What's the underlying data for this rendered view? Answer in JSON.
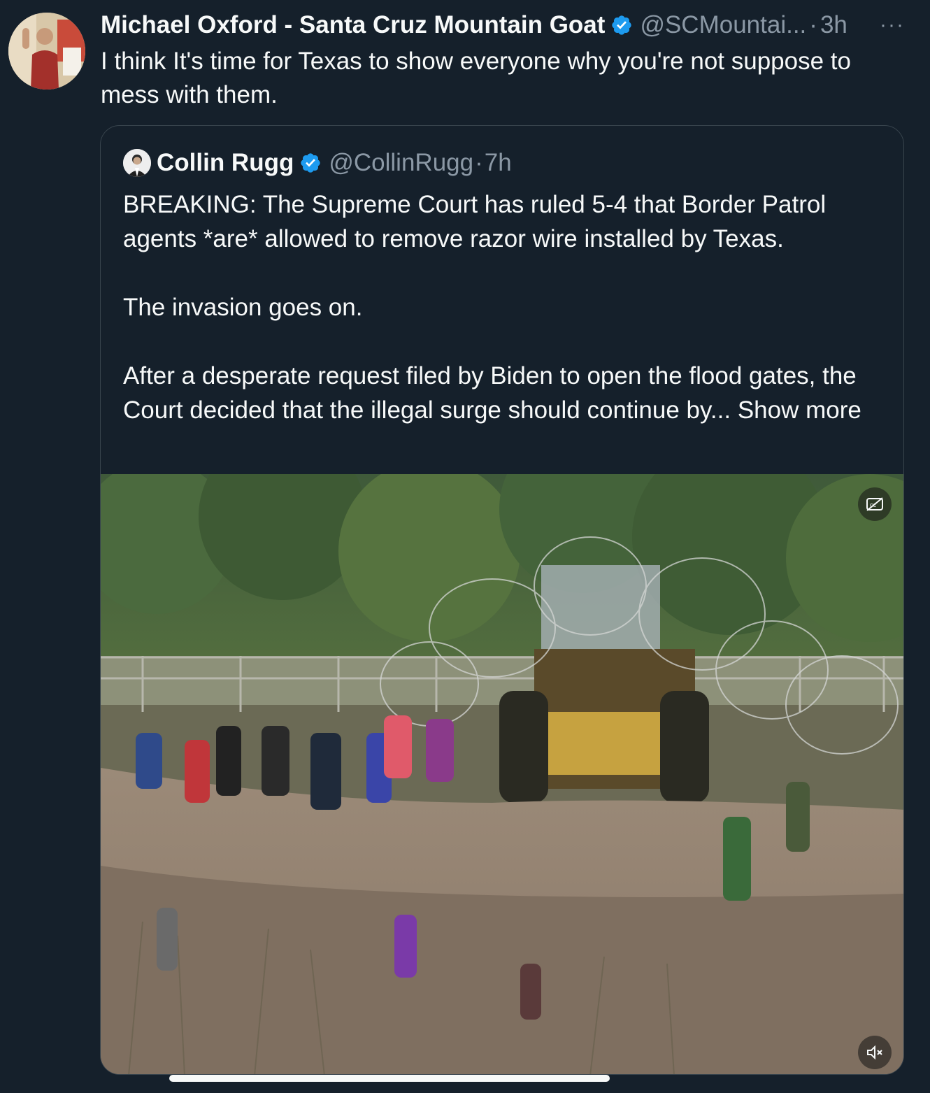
{
  "tweet": {
    "author_name": "Michael Oxford - Santa Cruz Mountain Goat",
    "handle": "@SCMountai...",
    "separator": "·",
    "time": "3h",
    "more_label": "···",
    "text": "I think It's time for Texas to show everyone why you're not suppose to mess with them.",
    "verified": true
  },
  "quote": {
    "author_name": "Collin Rugg",
    "handle": "@CollinRugg",
    "separator": "·",
    "time": "7h",
    "verified": true,
    "paragraph_1": "BREAKING: The Supreme Court has ruled 5-4 that Border Patrol agents *are* allowed to remove razor wire installed by Texas.",
    "paragraph_2": "The invasion goes on.",
    "paragraph_3": "After a desperate request filed by Biden to open the flood gates, the Court decided that the illegal surge should continue by...",
    "show_more": "Show more"
  },
  "media": {
    "cc_icon": "closed-captions-off-icon",
    "mute_icon": "speaker-muted-icon"
  },
  "colors": {
    "background": "#15202b",
    "text": "#f7f9f9",
    "secondary": "#8b98a5",
    "verified": "#1d9bf0",
    "border": "#38444d"
  }
}
